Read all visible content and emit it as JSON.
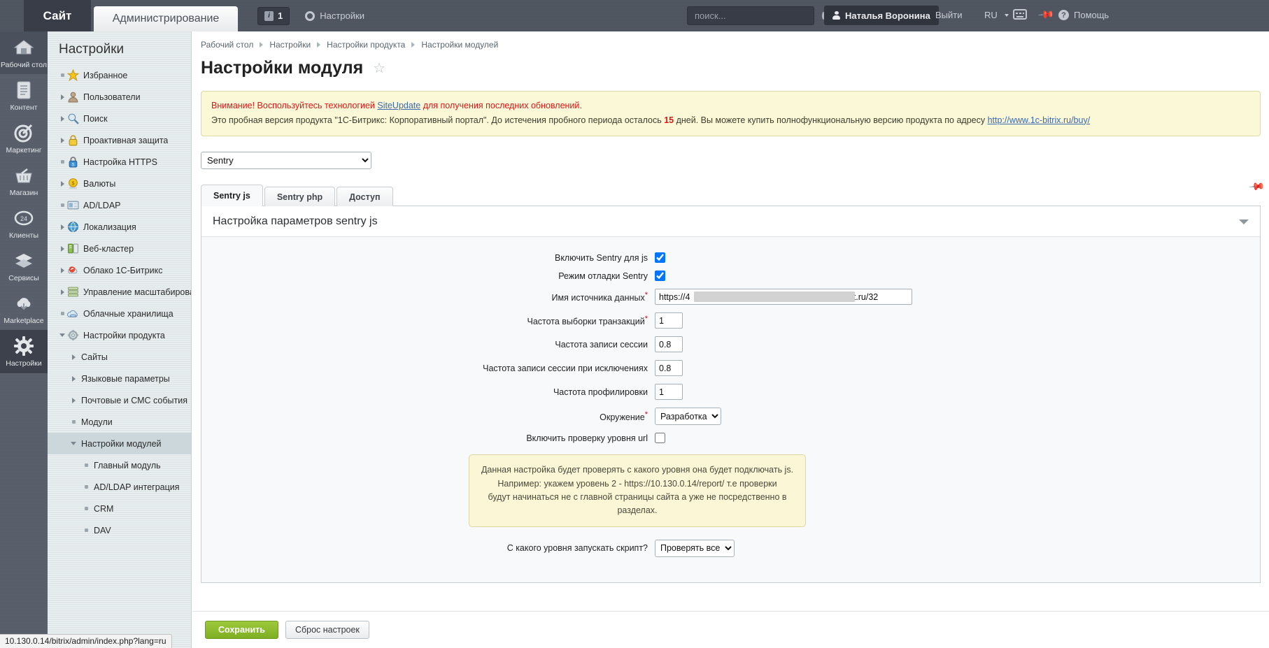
{
  "topbar": {
    "site_label": "Сайт",
    "admin_label": "Администрирование",
    "info_count": "1",
    "settings_label": "Настройки",
    "search_placeholder": "поиск...",
    "search_value": "",
    "user_name": "Наталья Воронина",
    "logout_label": "Выйти",
    "lang_label": "RU",
    "help_label": "Помощь"
  },
  "rail": {
    "items": [
      {
        "label": "Рабочий стол",
        "icon": "home-icon"
      },
      {
        "label": "Контент",
        "icon": "document-icon"
      },
      {
        "label": "Маркетинг",
        "icon": "target-icon"
      },
      {
        "label": "Магазин",
        "icon": "basket-icon"
      },
      {
        "label": "Клиенты",
        "icon": "bitrix24-icon"
      },
      {
        "label": "Сервисы",
        "icon": "layers-icon"
      },
      {
        "label": "Marketplace",
        "icon": "cloud-download-icon"
      },
      {
        "label": "Настройки",
        "icon": "gear-icon"
      }
    ]
  },
  "sidebar": {
    "title": "Настройки",
    "items": [
      {
        "label": "Избранное",
        "marker": "dot",
        "icon": "star-icon",
        "indent": 0
      },
      {
        "label": "Пользователи",
        "marker": "arrow-r",
        "icon": "user-icon",
        "indent": 0
      },
      {
        "label": "Поиск",
        "marker": "arrow-r",
        "icon": "magnifier-icon",
        "indent": 0
      },
      {
        "label": "Проактивная защита",
        "marker": "arrow-r",
        "icon": "lock-icon",
        "indent": 0
      },
      {
        "label": "Настройка HTTPS",
        "marker": "dot",
        "icon": "https-lock-icon",
        "indent": 0
      },
      {
        "label": "Валюты",
        "marker": "arrow-r",
        "icon": "coin-icon",
        "indent": 0
      },
      {
        "label": "AD/LDAP",
        "marker": "dot",
        "icon": "ldap-icon",
        "indent": 0
      },
      {
        "label": "Локализация",
        "marker": "arrow-r",
        "icon": "globe-icon",
        "indent": 0
      },
      {
        "label": "Веб-кластер",
        "marker": "arrow-r",
        "icon": "server-icon",
        "indent": 0
      },
      {
        "label": "Облако 1С-Битрикс",
        "marker": "arrow-r",
        "icon": "cloud-bitrix-icon",
        "indent": 0
      },
      {
        "label": "Управление масштабирован",
        "marker": "arrow-r",
        "icon": "scaling-icon",
        "indent": 0
      },
      {
        "label": "Облачные хранилища",
        "marker": "dot",
        "icon": "cloud-storage-icon",
        "indent": 0
      },
      {
        "label": "Настройки продукта",
        "marker": "arrow-d",
        "icon": "product-gear-icon",
        "indent": 0
      },
      {
        "label": "Сайты",
        "marker": "arrow-r",
        "icon": "none",
        "indent": 1
      },
      {
        "label": "Языковые параметры",
        "marker": "arrow-r",
        "icon": "none",
        "indent": 1
      },
      {
        "label": "Почтовые и СМС события",
        "marker": "arrow-r",
        "icon": "none",
        "indent": 1
      },
      {
        "label": "Модули",
        "marker": "dot",
        "icon": "none",
        "indent": 1
      },
      {
        "label": "Настройки модулей",
        "marker": "arrow-d",
        "icon": "none",
        "indent": 1,
        "selected": true
      },
      {
        "label": "Главный модуль",
        "marker": "dot",
        "icon": "none",
        "indent": 2
      },
      {
        "label": "AD/LDAP интеграция",
        "marker": "dot",
        "icon": "none",
        "indent": 2
      },
      {
        "label": "CRM",
        "marker": "dot",
        "icon": "none",
        "indent": 2
      },
      {
        "label": "DAV",
        "marker": "dot",
        "icon": "none",
        "indent": 2
      }
    ]
  },
  "breadcrumb": {
    "items": [
      "Рабочий стол",
      "Настройки",
      "Настройки продукта",
      "Настройки модулей"
    ]
  },
  "page": {
    "title": "Настройки модуля"
  },
  "notice": {
    "line1_pre": "Внимание! Воспользуйтесь технологией ",
    "line1_link": "SiteUpdate",
    "line1_post": " для получения последних обновлений.",
    "line2_pre": "Это пробная версия продукта \"1С-Битрикс: Корпоративный портал\". До истечения пробного периода осталось ",
    "line2_days": "15",
    "line2_mid": " дней. Вы можете купить полнофункциональную версию продукта по адресу ",
    "line2_link": "http://www.1c-bitrix.ru/buy/"
  },
  "module_select": {
    "value": "Sentry",
    "options": [
      "Sentry"
    ]
  },
  "tabs": [
    {
      "label": "Sentry js",
      "active": true
    },
    {
      "label": "Sentry php",
      "active": false
    },
    {
      "label": "Доступ",
      "active": false
    }
  ],
  "panel": {
    "title": "Настройка параметров sentry js"
  },
  "form": {
    "enable_js_label": "Включить Sentry для js",
    "enable_js_checked": true,
    "debug_label": "Режим отладки Sentry",
    "debug_checked": true,
    "dsn_label": "Имя источника данных",
    "dsn_value": "https://4                                            :@sentry.mcart.ru/32",
    "dsn_prefix": "https://4",
    "dsn_suffix": ":@sentry.mcart.ru/32",
    "tx_sample_label": "Частота выборки транзакций",
    "tx_sample_value": "1",
    "session_rate_label": "Частота записи сессии",
    "session_rate_value": "0.8",
    "session_error_rate_label": "Частота записи сессии при исключениях",
    "session_error_rate_value": "0.8",
    "profile_rate_label": "Частота профилировки",
    "profile_rate_value": "1",
    "env_label": "Окружение",
    "env_value": "Разработка",
    "env_options": [
      "Разработка"
    ],
    "url_check_label": "Включить проверку уровня url",
    "url_check_checked": false,
    "hint_line1": "Данная настройка будет проверять с какого уровня она будет подключать js.",
    "hint_line2": "Например: укажем уровень 2 - https://10.130.0.14/report/ т.е проверки",
    "hint_line3": "будут начинаться не с главной страницы сайта а уже не посредственно в разделах.",
    "level_label": "С какого уровня запускать скрипт?",
    "level_value": "Проверять все",
    "level_options": [
      "Проверять все"
    ]
  },
  "footer": {
    "save_label": "Сохранить",
    "reset_label": "Сброс настроек"
  },
  "statusbar": {
    "url": "10.130.0.14/bitrix/admin/index.php?lang=ru"
  }
}
